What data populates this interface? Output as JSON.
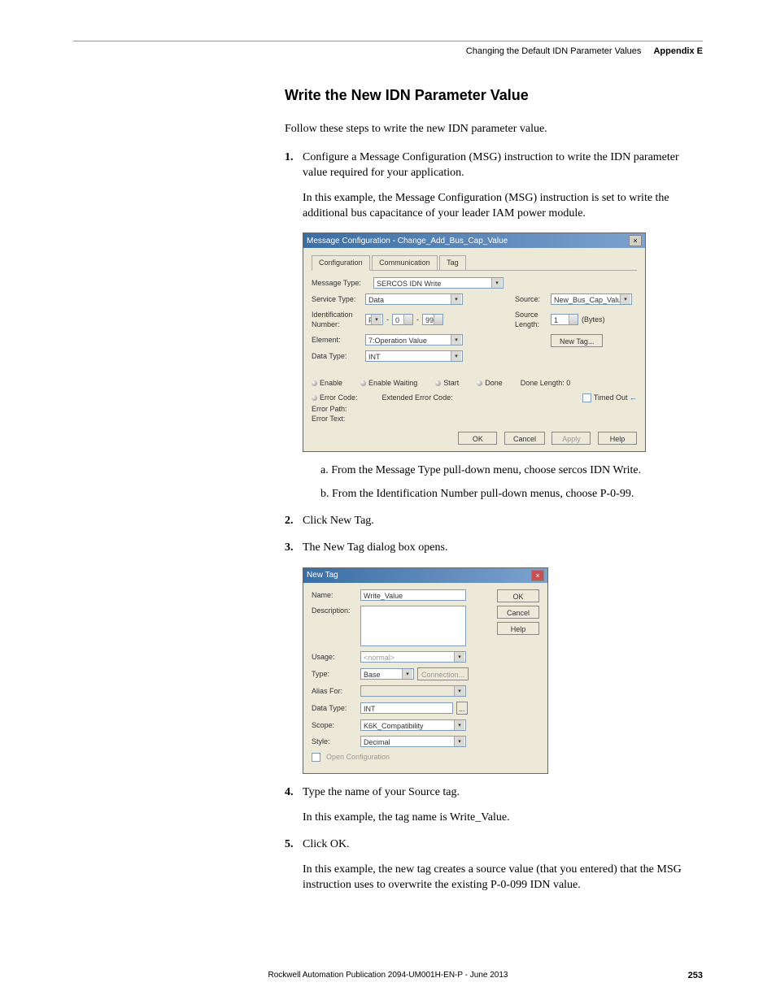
{
  "header": {
    "title": "Changing the Default IDN Parameter Values",
    "appendix": "Appendix E"
  },
  "h2": "Write the New IDN Parameter Value",
  "intro": "Follow these steps to write the new IDN parameter value.",
  "step1": {
    "main": "Configure a Message Configuration (MSG) instruction to write the IDN parameter value required for your application.",
    "para": "In this example, the Message Configuration (MSG) instruction is set to write the additional bus capacitance of your leader IAM power module.",
    "sub_a": "a.  From the Message Type pull-down menu, choose sercos IDN Write.",
    "sub_b": "b.  From the Identification Number pull-down menus, choose P-0-99."
  },
  "step2": "Click New Tag.",
  "step3": "The New Tag dialog box opens.",
  "step4": {
    "main": "Type the name of your Source tag.",
    "para": "In this example, the tag name is Write_Value."
  },
  "step5": {
    "main": "Click OK.",
    "para": "In this example, the new tag creates a source value (that you entered) that the MSG instruction uses to overwrite the existing P-0-099 IDN value."
  },
  "dlg1": {
    "title": "Message Configuration - Change_Add_Bus_Cap_Value",
    "tabs": {
      "t1": "Configuration",
      "t2": "Communication",
      "t3": "Tag"
    },
    "labels": {
      "msgtype": "Message Type:",
      "svctype": "Service Type:",
      "idnum": "Identification Number:",
      "element": "Element:",
      "datatype": "Data Type:",
      "source": "Source:",
      "srclen": "Source Length:"
    },
    "vals": {
      "msgtype": "SERCOS IDN Write",
      "svctype": "Data",
      "id_p": "P",
      "id_0": "0",
      "id_99": "99",
      "element": "7:Operation Value",
      "datatype": "INT",
      "source": "New_Bus_Cap_Value",
      "srclen": "1",
      "bytes": "(Bytes)",
      "newtag": "New Tag..."
    },
    "status": {
      "enable": "Enable",
      "enablewait": "Enable Waiting",
      "start": "Start",
      "done": "Done",
      "donelen": "Done Length: 0",
      "errcode": "Error Code:",
      "extcode": "Extended Error Code:",
      "timedout": "Timed Out",
      "errpath": "Error Path:",
      "errtext": "Error Text:"
    },
    "btns": {
      "ok": "OK",
      "cancel": "Cancel",
      "apply": "Apply",
      "help": "Help"
    }
  },
  "dlg2": {
    "title": "New Tag",
    "labels": {
      "name": "Name:",
      "desc": "Description:",
      "usage": "Usage:",
      "type": "Type:",
      "alias": "Alias For:",
      "datatype": "Data Type:",
      "scope": "Scope:",
      "style": "Style:",
      "openconf": "Open Configuration"
    },
    "vals": {
      "name": "Write_Value",
      "usage": "<normal>",
      "type": "Base",
      "conn": "Connection...",
      "datatype": "INT",
      "ellipsis": "...",
      "scope": "K6K_Compatibility",
      "style": "Decimal"
    },
    "btns": {
      "ok": "OK",
      "cancel": "Cancel",
      "help": "Help"
    }
  },
  "footer": {
    "text": "Rockwell Automation Publication 2094-UM001H-EN-P - June 2013",
    "page": "253"
  }
}
